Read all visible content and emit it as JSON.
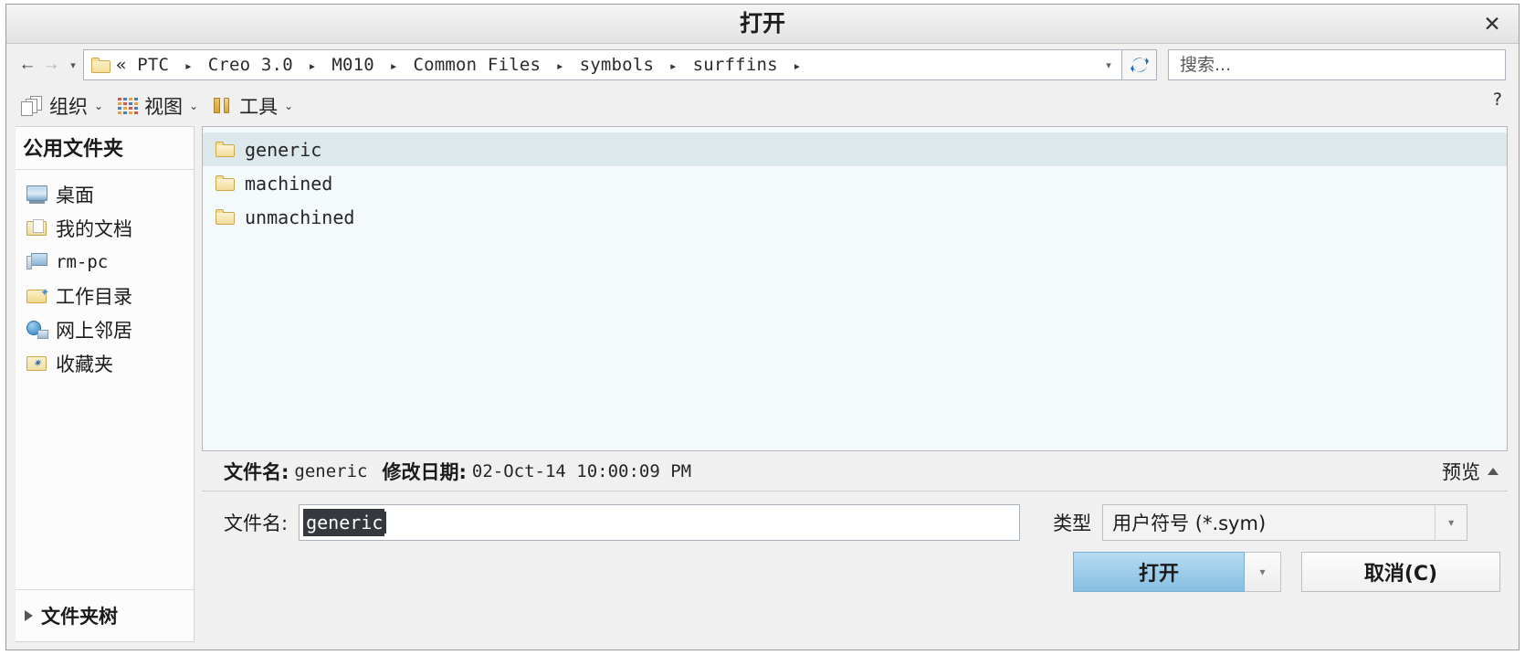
{
  "window": {
    "title": "打开",
    "close_label": "✕"
  },
  "nav": {
    "back_icon": "←",
    "forward_icon": "→",
    "history_caret": "▾",
    "breadcrumb_prefix": "«",
    "breadcrumb": [
      "PTC",
      "Creo 3.0",
      "M010",
      "Common Files",
      "symbols",
      "surffins"
    ],
    "breadcrumb_separator": "▸",
    "address_caret": "▾",
    "refresh_icon": "refresh-icon",
    "search_placeholder": "搜索..."
  },
  "toolbar": {
    "items": [
      {
        "label": "组织",
        "icon": "organize-icon",
        "caret": "⌄"
      },
      {
        "label": "视图",
        "icon": "grid-icon",
        "caret": "⌄"
      },
      {
        "label": "工具",
        "icon": "tools-icon",
        "caret": "⌄"
      }
    ],
    "help_cursor": "?"
  },
  "sidebar": {
    "header": "公用文件夹",
    "items": [
      {
        "label": "桌面",
        "icon": "desktop-icon",
        "mono": false
      },
      {
        "label": "我的文档",
        "icon": "documents-icon",
        "mono": false
      },
      {
        "label": "rm-pc",
        "icon": "computer-icon",
        "mono": true
      },
      {
        "label": "工作目录",
        "icon": "working-directory-icon",
        "mono": false
      },
      {
        "label": "网上邻居",
        "icon": "network-icon",
        "mono": false
      },
      {
        "label": "收藏夹",
        "icon": "favorites-icon",
        "mono": false
      }
    ],
    "footer": {
      "label": "文件夹树",
      "expander": "▶"
    }
  },
  "filelist": {
    "rows": [
      {
        "name": "generic",
        "icon": "folder-icon",
        "selected": true
      },
      {
        "name": "machined",
        "icon": "folder-icon",
        "selected": false
      },
      {
        "name": "unmachined",
        "icon": "folder-icon",
        "selected": false
      }
    ]
  },
  "infobar": {
    "filename_key": "文件名:",
    "filename_value": "generic",
    "modified_key": "修改日期:",
    "modified_value": "02-Oct-14 10:00:09 PM",
    "preview_label": "预览",
    "preview_caret": "▲"
  },
  "form": {
    "filename_label": "文件名:",
    "filename_value": "generic",
    "type_label": "类型",
    "type_value": "用户符号 (*.sym)",
    "type_caret": "▾"
  },
  "buttons": {
    "open": "打开",
    "open_split_caret": "▾",
    "cancel": "取消(C)"
  },
  "colors": {
    "accent": "#9ecdea",
    "selection_row": "#dde8ec",
    "text_selection": "#35383c",
    "refresh_icon": "#1f6fb5"
  }
}
